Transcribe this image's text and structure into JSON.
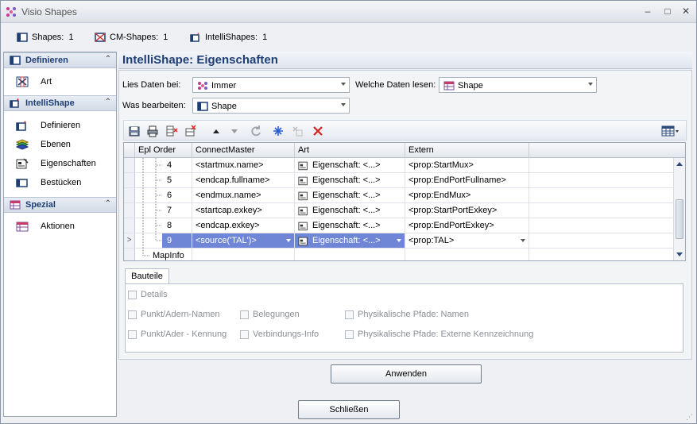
{
  "window": {
    "title": "Visio Shapes"
  },
  "counters": [
    {
      "label": "Shapes:",
      "value": "1"
    },
    {
      "label": "CM-Shapes:",
      "value": "1"
    },
    {
      "label": "IntelliShapes:",
      "value": "1"
    }
  ],
  "sidebar": {
    "sections": [
      {
        "title": "Definieren",
        "items": [
          {
            "label": "Art"
          }
        ]
      },
      {
        "title": "IntelliShape",
        "items": [
          {
            "label": "Definieren"
          },
          {
            "label": "Ebenen"
          },
          {
            "label": "Eigenschaften"
          },
          {
            "label": "Bestücken"
          }
        ]
      },
      {
        "title": "Spezial",
        "items": [
          {
            "label": "Aktionen"
          }
        ]
      }
    ]
  },
  "main": {
    "title": "IntelliShape:  Eigenschaften",
    "lies_daten_label": "Lies Daten bei:",
    "lies_daten_value": "Immer",
    "welche_daten_label": "Welche Daten lesen:",
    "welche_daten_value": "Shape",
    "was_bearbeiten_label": "Was bearbeiten:",
    "was_bearbeiten_value": "Shape"
  },
  "grid": {
    "columns": [
      "Epl",
      "Order",
      "ConnectMaster",
      "Art",
      "Extern"
    ],
    "rows": [
      {
        "order": "4",
        "cm": "<startmux.name>",
        "art": "Eigenschaft: <...>",
        "extern": "<prop:StartMux>"
      },
      {
        "order": "5",
        "cm": "<endcap.fullname>",
        "art": "Eigenschaft: <...>",
        "extern": "<prop:EndPortFullname>"
      },
      {
        "order": "6",
        "cm": "<endmux.name>",
        "art": "Eigenschaft: <...>",
        "extern": "<prop:EndMux>"
      },
      {
        "order": "7",
        "cm": "<startcap.exkey>",
        "art": "Eigenschaft: <...>",
        "extern": "<prop:StartPortExkey>"
      },
      {
        "order": "8",
        "cm": "<endcap.exkey>",
        "art": "Eigenschaft: <...>",
        "extern": "<prop:EndPortExkey>"
      },
      {
        "order": "9",
        "cm": "<source('TAL')>",
        "art": "Eigenschaft: <...>",
        "extern": "<prop:TAL>"
      }
    ],
    "mapinfo_label": "MapInfo"
  },
  "tabs": {
    "bauteile": "Bauteile"
  },
  "checkboxes": {
    "details": "Details",
    "punkt_adern_namen": "Punkt/Adern-Namen",
    "belegungen": "Belegungen",
    "phys_pfade_namen": "Physikalische Pfade: Namen",
    "punkt_ader_kennung": "Punkt/Ader - Kennung",
    "verbindungs_info": "Verbindungs-Info",
    "phys_pfade_extern": "Physikalische Pfade: Externe Kennzeichnung"
  },
  "buttons": {
    "anwenden": "Anwenden",
    "schliessen": "Schließen"
  },
  "row_selector_marker": ">",
  "colors": {
    "accent": "#1e3e74",
    "selection": "#6f86d6"
  }
}
